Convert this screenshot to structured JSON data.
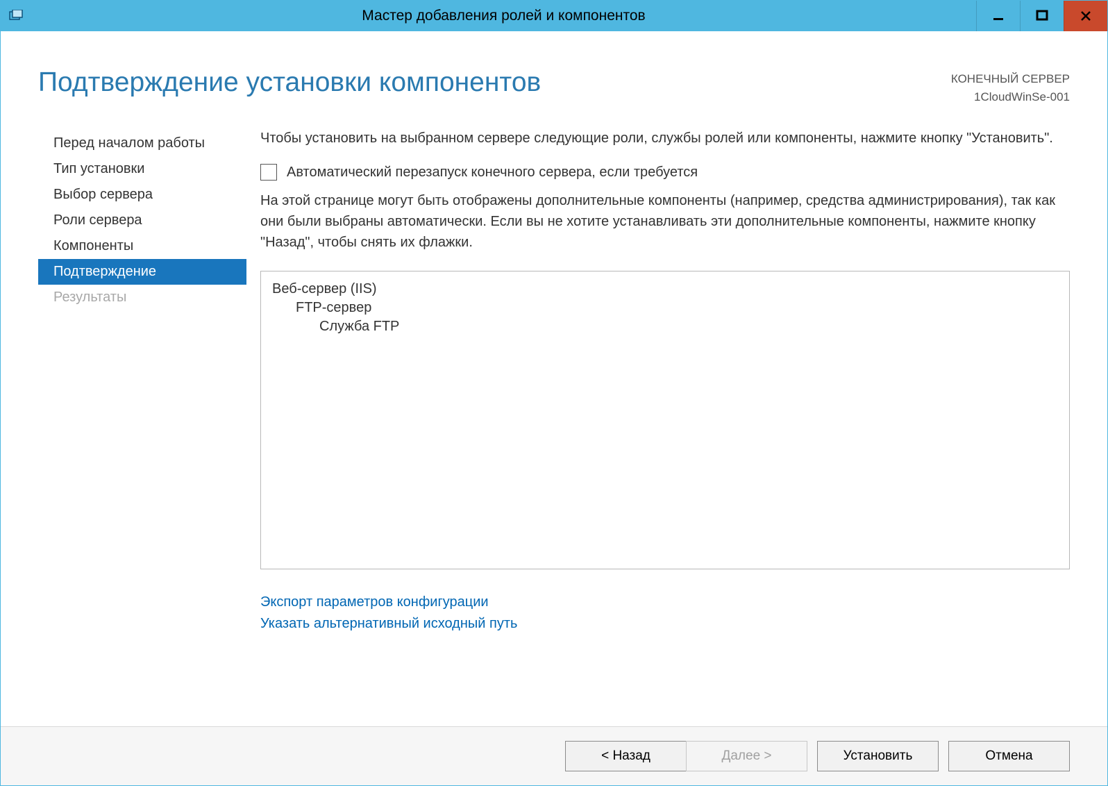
{
  "titlebar": {
    "title": "Мастер добавления ролей и компонентов"
  },
  "header": {
    "heading": "Подтверждение установки компонентов",
    "destination_label": "КОНЕЧНЫЙ СЕРВЕР",
    "destination_value": "1CloudWinSe-001"
  },
  "sidebar": {
    "items": [
      {
        "label": "Перед началом работы",
        "active": false,
        "disabled": false
      },
      {
        "label": "Тип установки",
        "active": false,
        "disabled": false
      },
      {
        "label": "Выбор сервера",
        "active": false,
        "disabled": false
      },
      {
        "label": "Роли сервера",
        "active": false,
        "disabled": false
      },
      {
        "label": "Компоненты",
        "active": false,
        "disabled": false
      },
      {
        "label": "Подтверждение",
        "active": true,
        "disabled": false
      },
      {
        "label": "Результаты",
        "active": false,
        "disabled": true
      }
    ]
  },
  "content": {
    "intro": "Чтобы установить на выбранном сервере следующие роли, службы ролей или компоненты, нажмите кнопку \"Установить\".",
    "checkbox_label": "Автоматический перезапуск конечного сервера, если требуется",
    "info": "На этой странице могут быть отображены дополнительные компоненты (например, средства администрирования), так как они были выбраны автоматически. Если вы не хотите устанавливать эти дополнительные компоненты, нажмите кнопку \"Назад\", чтобы снять их флажки.",
    "selection": {
      "root": "Веб-сервер (IIS)",
      "level1": "FTP-сервер",
      "level2": "Служба FTP"
    },
    "links": {
      "export": "Экспорт параметров конфигурации",
      "alt_path": "Указать альтернативный исходный путь"
    }
  },
  "footer": {
    "back": "< Назад",
    "next": "Далее >",
    "install": "Установить",
    "cancel": "Отмена"
  }
}
